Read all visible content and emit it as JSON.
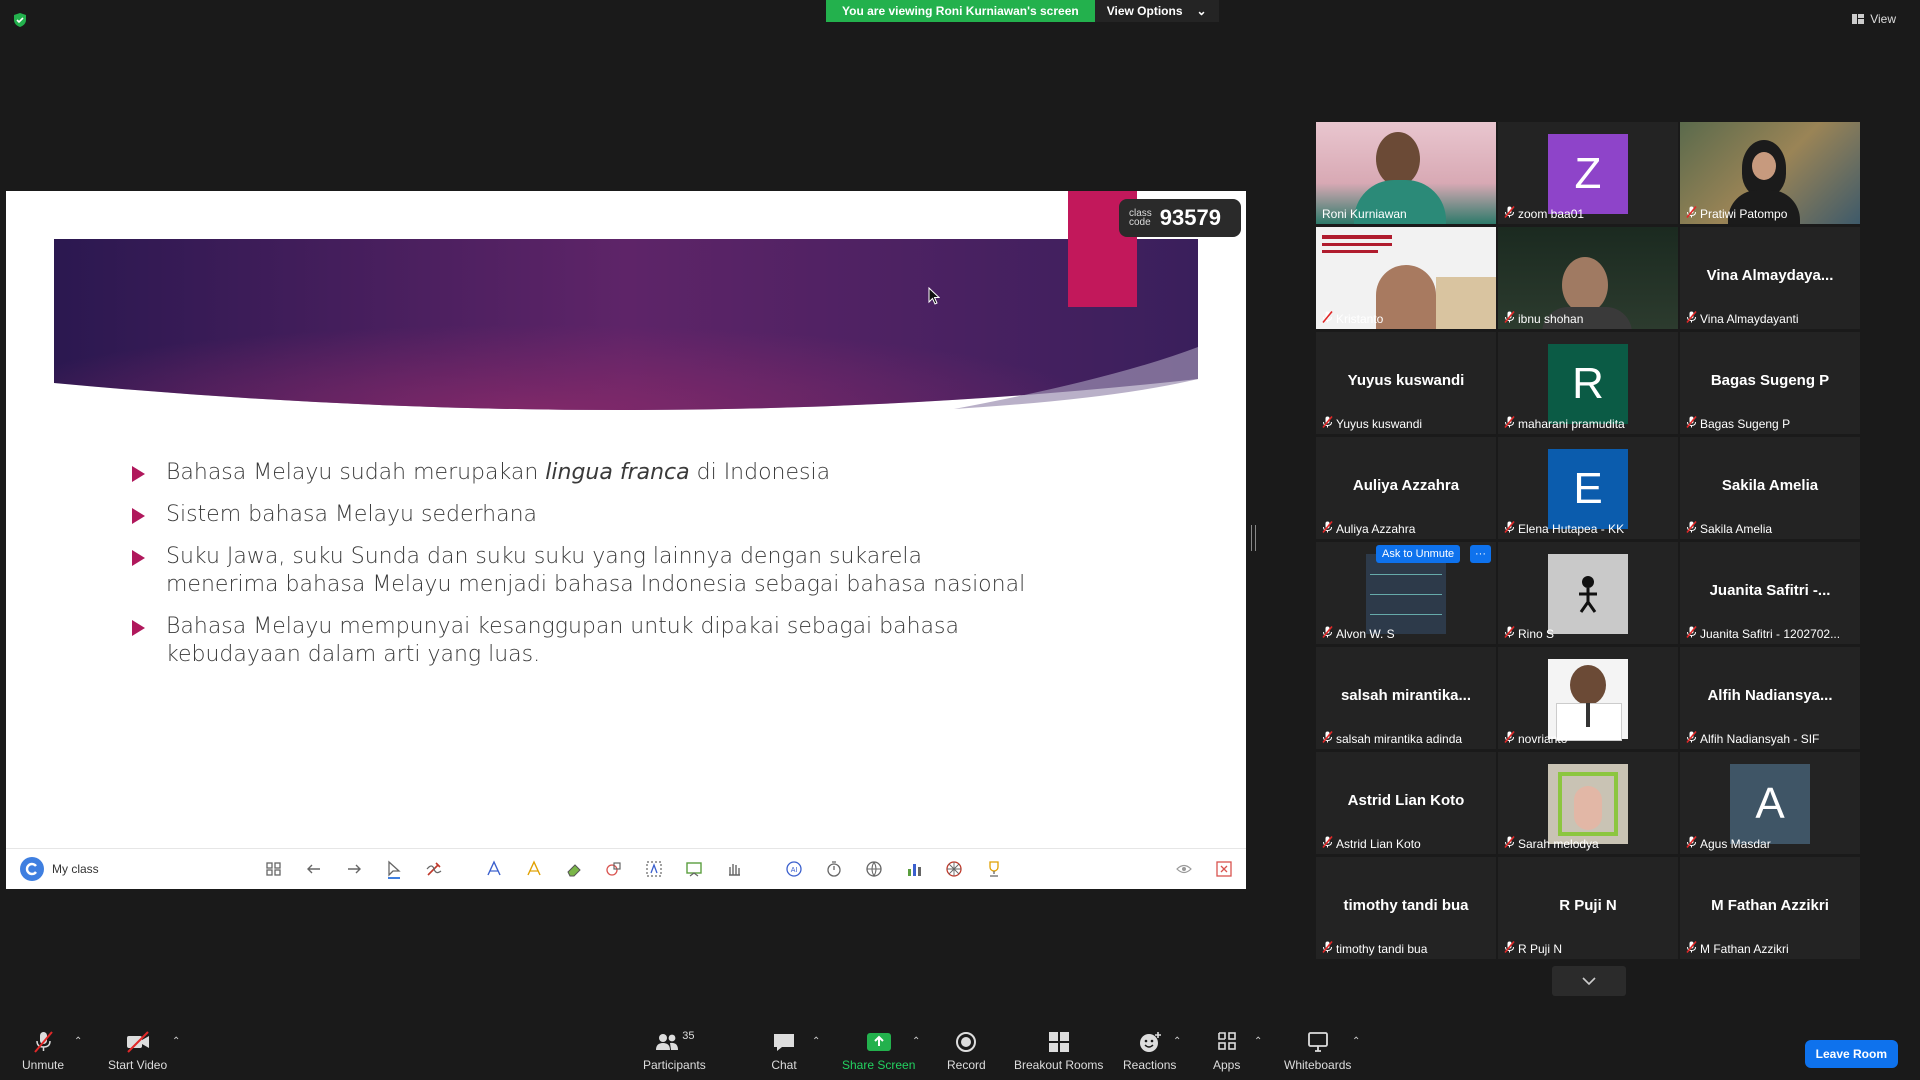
{
  "top": {
    "viewing_banner": "You are viewing Roni Kurniawan's screen",
    "view_options": "View Options",
    "view_label": "View"
  },
  "slide": {
    "class_code_label_1": "class",
    "class_code_label_2": "code",
    "class_code": "93579",
    "bullets": [
      "Bahasa Melayu sudah merupakan",
      "lingua franca",
      "di Indonesia",
      "Sistem bahasa Melayu sederhana",
      "Suku Jawa, suku Sunda dan suku suku yang lainnya dengan sukarela menerima bahasa Melayu menjadi bahasa Indonesia sebagai bahasa nasional",
      "Bahasa Melayu mempunyai kesanggupan untuk dipakai sebagai bahasa kebudayaan dalam arti yang luas."
    ],
    "toolbar_label": "My class"
  },
  "gallery": {
    "ask_to_unmute": "Ask to Unmute",
    "more": "···",
    "tiles": [
      {
        "name": "Roni Kurniawan",
        "center": "",
        "avatar": "",
        "avatar_color": "",
        "type": "video-roni",
        "active": true,
        "muted": false
      },
      {
        "name": "zoom baa01",
        "center": "",
        "avatar": "Z",
        "avatar_color": "#8e44c9",
        "type": "avatar",
        "muted": true
      },
      {
        "name": "Pratiwi Patompo",
        "center": "",
        "avatar": "",
        "avatar_color": "",
        "type": "video-pratiwi",
        "muted": true
      },
      {
        "name": "Kristanto",
        "center": "",
        "avatar": "",
        "avatar_color": "",
        "type": "video-kristanto",
        "muted": true
      },
      {
        "name": "ibnu shohan",
        "center": "",
        "avatar": "",
        "avatar_color": "",
        "type": "video-ibnu",
        "muted": true
      },
      {
        "name": "Vina Almaydayanti",
        "center": "Vina  Almaydaya...",
        "avatar": "",
        "avatar_color": "",
        "type": "text",
        "muted": true
      },
      {
        "name": "Yuyus kuswandi",
        "center": "Yuyus kuswandi",
        "avatar": "",
        "avatar_color": "",
        "type": "text",
        "muted": true
      },
      {
        "name": "maharani pramudita",
        "center": "",
        "avatar": "R",
        "avatar_color": "#0b5b45",
        "type": "avatar",
        "muted": true
      },
      {
        "name": "Bagas Sugeng P",
        "center": "Bagas Sugeng P",
        "avatar": "",
        "avatar_color": "",
        "type": "text",
        "muted": true
      },
      {
        "name": "Auliya Azzahra",
        "center": "Auliya Azzahra",
        "avatar": "",
        "avatar_color": "",
        "type": "text",
        "muted": true
      },
      {
        "name": "Elena Hutapea - KK",
        "center": "",
        "avatar": "E",
        "avatar_color": "#0b5cad",
        "type": "avatar",
        "muted": true
      },
      {
        "name": "Sakila Amelia",
        "center": "Sakila Amelia",
        "avatar": "",
        "avatar_color": "",
        "type": "text",
        "muted": true
      },
      {
        "name": "Alvon W. S",
        "center": "",
        "avatar": "",
        "avatar_color": "",
        "type": "video-alvon",
        "muted": true
      },
      {
        "name": "Rino S",
        "center": "",
        "avatar": "",
        "avatar_color": "#c9c9c9",
        "type": "image-rino",
        "muted": true
      },
      {
        "name": "Juanita Safitri - 1202702...",
        "center": "Juanita  Safitri  -...",
        "avatar": "",
        "avatar_color": "",
        "type": "text",
        "muted": true
      },
      {
        "name": "salsah mirantika adinda",
        "center": "salsah  mirantika...",
        "avatar": "",
        "avatar_color": "",
        "type": "text",
        "muted": true
      },
      {
        "name": "novrianto",
        "center": "",
        "avatar": "",
        "avatar_color": "",
        "type": "image-novrianto",
        "muted": true
      },
      {
        "name": "Alfih Nadiansyah - SIF",
        "center": "Alfih  Nadiansya...",
        "avatar": "",
        "avatar_color": "",
        "type": "text",
        "muted": true
      },
      {
        "name": "Astrid Lian Koto",
        "center": "Astrid Lian Koto",
        "avatar": "",
        "avatar_color": "",
        "type": "text",
        "muted": true
      },
      {
        "name": "Sarah melodya",
        "center": "",
        "avatar": "",
        "avatar_color": "",
        "type": "image-sarah",
        "muted": true
      },
      {
        "name": "Agus Masdar",
        "center": "",
        "avatar": "A",
        "avatar_color": "#3f5566",
        "type": "avatar",
        "muted": true
      },
      {
        "name": "timothy tandi bua",
        "center": "timothy tandi bua",
        "avatar": "",
        "avatar_color": "",
        "type": "text",
        "muted": true
      },
      {
        "name": "R Puji N",
        "center": "R Puji N",
        "avatar": "",
        "avatar_color": "",
        "type": "text",
        "muted": true
      },
      {
        "name": "M Fathan Azzikri",
        "center": "M Fathan Azzikri",
        "avatar": "",
        "avatar_color": "",
        "type": "text",
        "muted": true
      }
    ]
  },
  "bottom": {
    "unmute": "Unmute",
    "start_video": "Start Video",
    "participants": "Participants",
    "participants_count": "35",
    "chat": "Chat",
    "share_screen": "Share Screen",
    "record": "Record",
    "breakout_rooms": "Breakout Rooms",
    "reactions": "Reactions",
    "apps": "Apps",
    "whiteboards": "Whiteboards",
    "leave_room": "Leave Room"
  }
}
